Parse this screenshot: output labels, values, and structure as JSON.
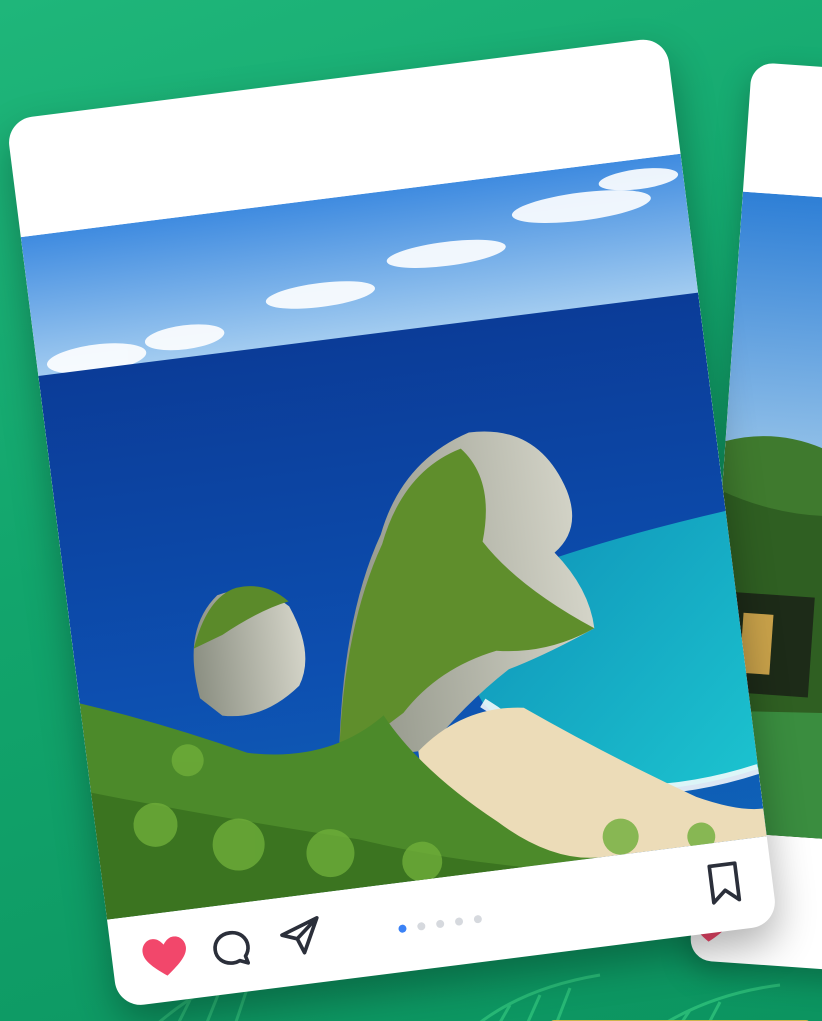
{
  "carousel": {
    "total_slides": 5,
    "active_slide": 1
  },
  "colors": {
    "background": "#14a86e",
    "heart": "#f2476b",
    "icon_stroke": "#2b2f3a",
    "dot_active": "#3b82f6",
    "dot_inactive": "#d6d9de"
  },
  "post": {
    "liked": true
  },
  "icons": {
    "like": "heart-icon",
    "comment": "comment-icon",
    "share": "send-icon",
    "save": "bookmark-icon"
  }
}
